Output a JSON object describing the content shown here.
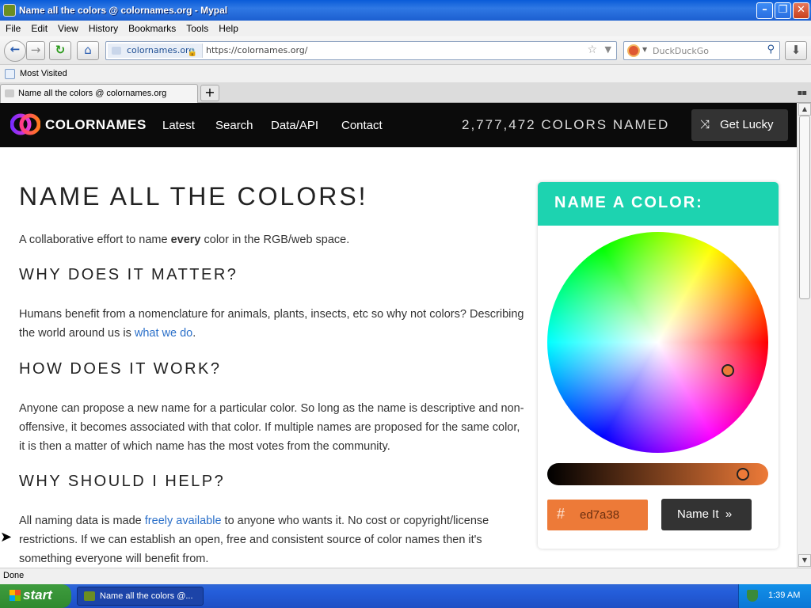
{
  "window": {
    "title": "Name all the colors @ colornames.org - Mypal"
  },
  "menu": [
    "File",
    "Edit",
    "View",
    "History",
    "Bookmarks",
    "Tools",
    "Help"
  ],
  "nav": {
    "identity": "colornames.org",
    "url": "https://colornames.org/",
    "search_placeholder": "DuckDuckGo"
  },
  "bookmarks": {
    "most_visited": "Most Visited"
  },
  "tabs": [
    {
      "label": "Name all the colors @ colornames.org"
    }
  ],
  "site": {
    "brand": "COLORNAMES",
    "links": [
      "Latest",
      "Search",
      "Data/API",
      "Contact"
    ],
    "count": "2,777,472 COLORS NAMED",
    "lucky": "Get Lucky"
  },
  "page": {
    "h1": "NAME ALL THE COLORS!",
    "intro_pre": "A collaborative effort to name ",
    "intro_bold": "every",
    "intro_post": " color in the RGB/web space.",
    "h2_1": "WHY DOES IT MATTER?",
    "p1_pre": "Humans benefit from a nomenclature for animals, plants, insects, etc so why not colors? Describing the world around us is ",
    "p1_link": "what we do",
    "p1_post": ".",
    "h2_2": "HOW DOES IT WORK?",
    "p2": "Anyone can propose a new name for a particular color. So long as the name is descriptive and non-offensive, it becomes associated with that color. If multiple names are proposed for the same color, it is then a matter of which name has the most votes from the community.",
    "h2_3": "WHY SHOULD I HELP?",
    "p3_pre": "All naming data is made ",
    "p3_link": "freely available",
    "p3_post": " to anyone who wants it. No cost or copyright/license restrictions. If we can establish an open, free and consistent source of color names then it's something everyone will benefit from."
  },
  "widget": {
    "heading": "NAME A COLOR:",
    "hash": "#",
    "hex": "ed7a38",
    "name_it": "Name It",
    "selected_color": "#ed7a38",
    "accent_color": "#1dd3b0"
  },
  "status": "Done",
  "taskbar": {
    "start": "start",
    "item": "Name all the colors @...",
    "clock": "1:39 AM"
  }
}
